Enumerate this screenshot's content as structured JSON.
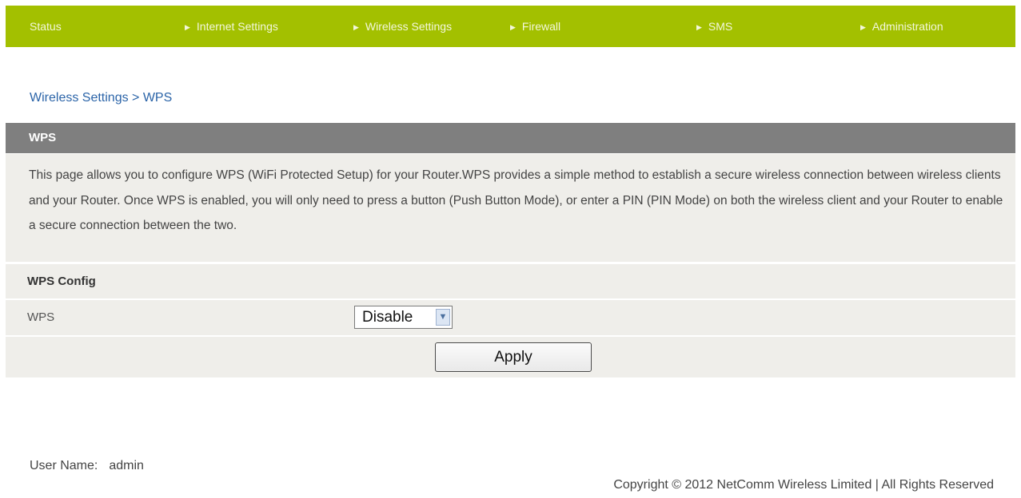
{
  "nav": {
    "items": [
      {
        "label": "Status",
        "arrow": false
      },
      {
        "label": "Internet Settings",
        "arrow": true
      },
      {
        "label": "Wireless Settings",
        "arrow": true
      },
      {
        "label": "Firewall",
        "arrow": true
      },
      {
        "label": "SMS",
        "arrow": true
      },
      {
        "label": "Administration",
        "arrow": true
      }
    ]
  },
  "breadcrumb": "Wireless Settings > WPS",
  "panel": {
    "title": "WPS",
    "description": "This page allows you to configure WPS (WiFi Protected Setup) for your Router.WPS provides a simple method to establish a secure wireless connection between wireless clients and your Router. Once WPS is enabled, you will only need to press a button (Push Button Mode), or enter a PIN (PIN Mode) on both the wireless client and your Router to enable a secure connection between the two."
  },
  "config": {
    "section_title": "WPS Config",
    "wps_label": "WPS",
    "wps_value": "Disable",
    "apply_label": "Apply"
  },
  "footer": {
    "username_label": "User Name:",
    "username_value": "admin",
    "copyright": "Copyright © 2012 NetComm Wireless Limited  |  All Rights Reserved"
  },
  "colors": {
    "nav_bg": "#a3c000",
    "header_bg": "#7f7f7f",
    "panel_bg": "#efeeea",
    "link": "#2b64a8"
  },
  "icons": {
    "nav_arrow": "play-triangle-icon",
    "select_arrow": "chevron-down-icon"
  }
}
